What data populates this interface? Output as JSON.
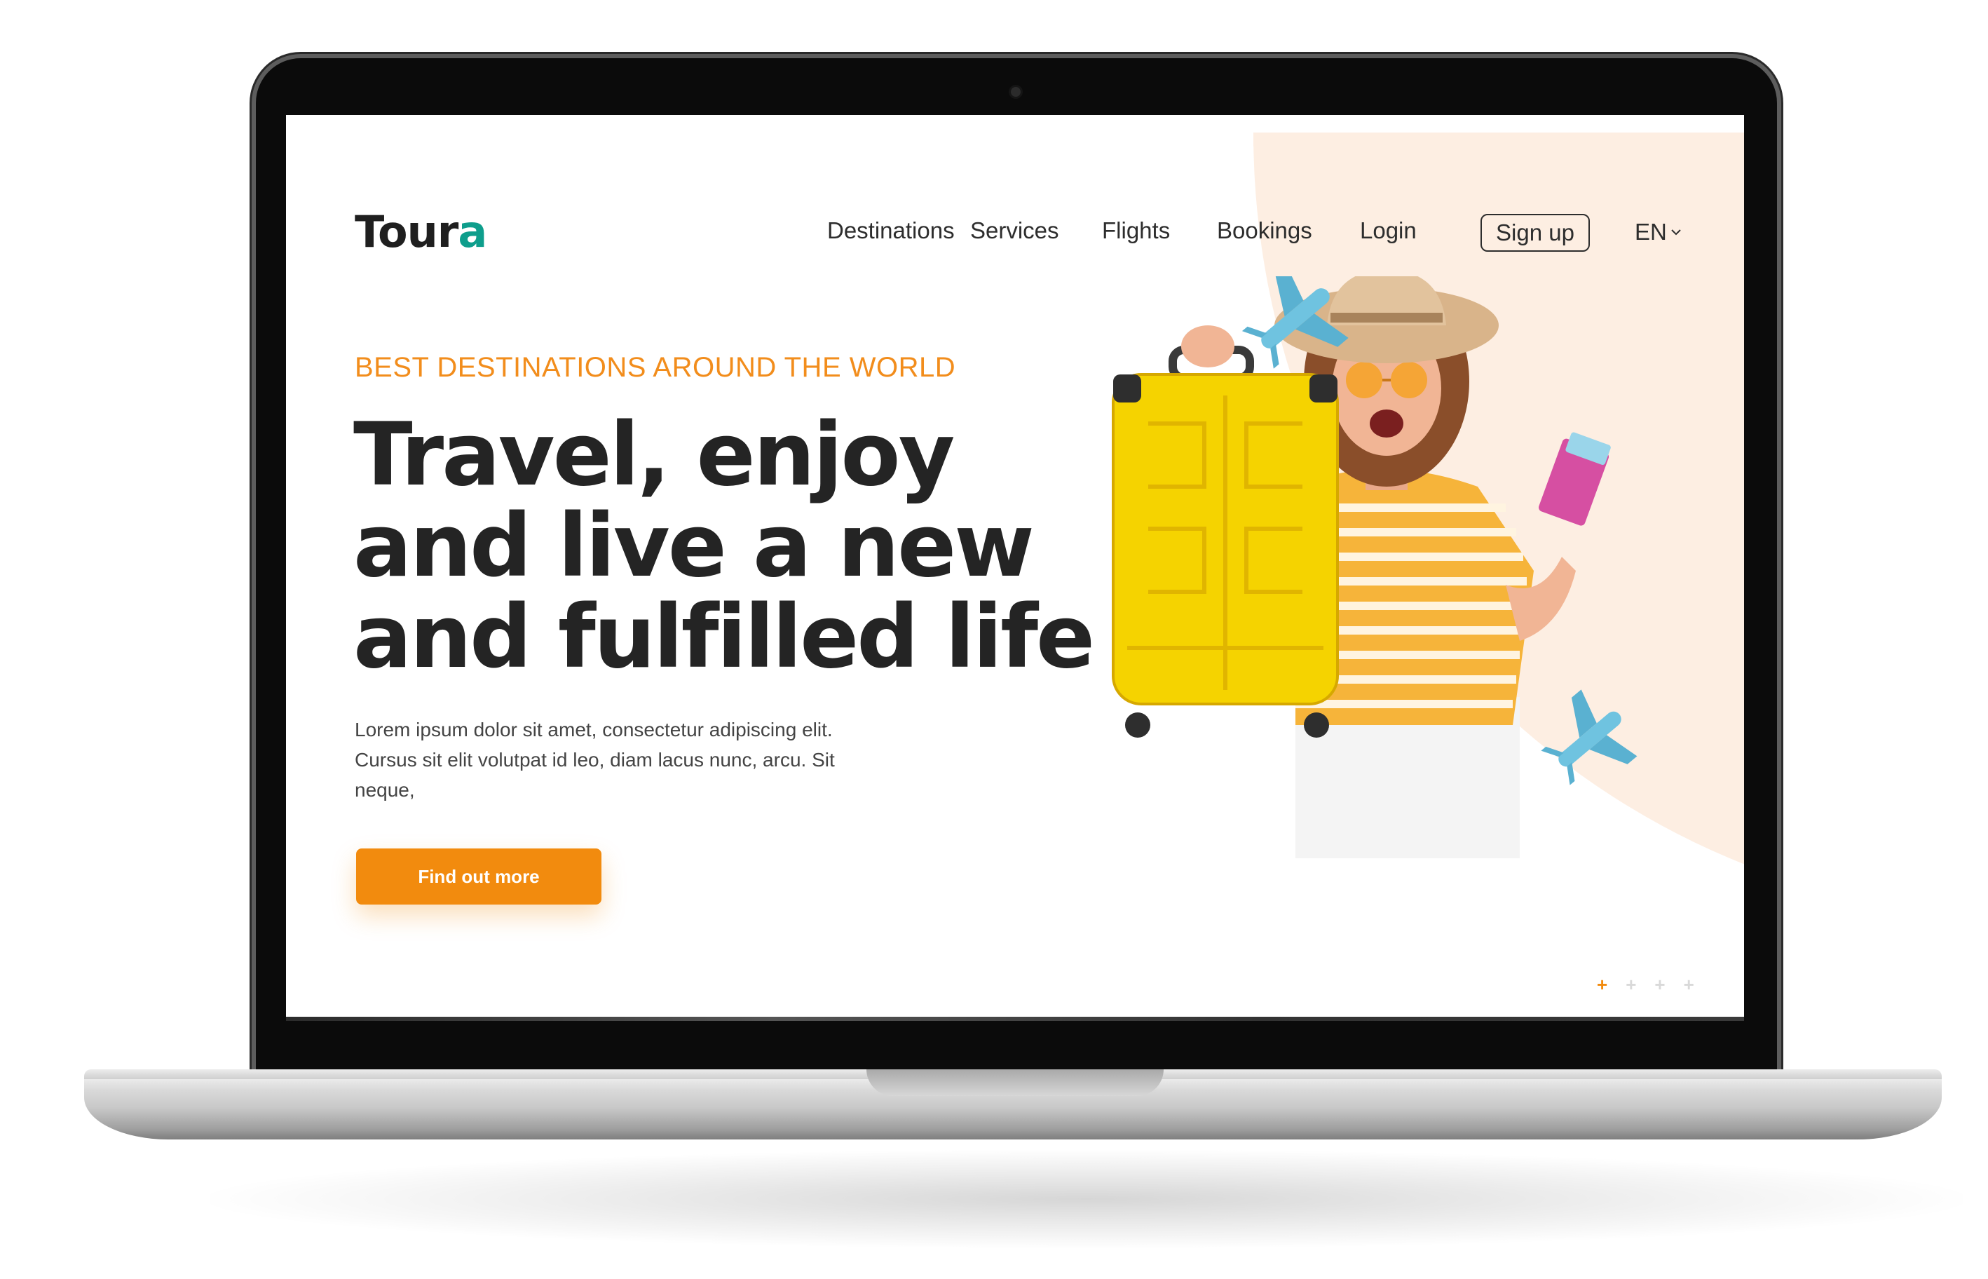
{
  "brand": {
    "name_main": "To",
    "name_tail": "ur",
    "name_dot": "a"
  },
  "nav": {
    "items": [
      "Destinations",
      "Services",
      "Flights",
      "Bookings",
      "Login"
    ],
    "signup_label": "Sign up",
    "language": "EN"
  },
  "hero": {
    "eyebrow": "BEST DESTINATIONS AROUND THE WORLD",
    "headline_lines": [
      "Travel, enjoy",
      "and live a new",
      "and fulfilled life"
    ],
    "body": "Lorem ipsum dolor sit amet, consectetur adipiscing elit. Cursus sit elit volutpat id leo, diam lacus nunc, arcu. Sit neque,",
    "cta_label": "Find out more"
  },
  "pager": {
    "marks": [
      "+",
      "+",
      "+",
      "+"
    ],
    "active_index": 0
  },
  "colors": {
    "accent": "#f28b0e",
    "eyebrow": "#f28d1c",
    "peach_bg": "#fdeee2",
    "suitcase": "#f5d300",
    "plane": "#6fc3e0",
    "logo_dot": "#0e9e8c"
  },
  "icons": [
    "chevron-down-icon",
    "plane-icon",
    "suitcase-icon",
    "passport-icon"
  ]
}
